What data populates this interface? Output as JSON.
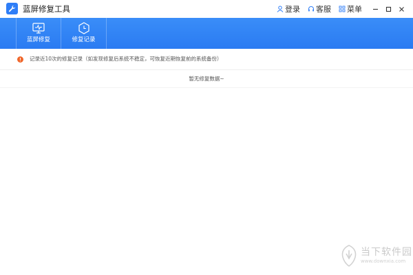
{
  "app": {
    "title": "蓝屏修复工具",
    "icon": "wrench-icon",
    "brand_color": "#2f7ef7"
  },
  "titlebar": {
    "login_label": "登录",
    "support_label": "客服",
    "menu_label": "菜单"
  },
  "toolbar": {
    "items": [
      {
        "label": "蓝屏修复",
        "icon": "monitor-icon"
      },
      {
        "label": "修复记录",
        "icon": "clock-hexagon-icon"
      }
    ]
  },
  "notice": {
    "text": "记录近10次的修复记录（如发现修复后系统不稳定，可恢复近期恢复前的系统备份）",
    "icon_color": "#f0662a"
  },
  "records": {
    "empty_text": "暂无修复数据~"
  },
  "watermark": {
    "title": "当下软件园",
    "url": "www.downxia.com"
  }
}
